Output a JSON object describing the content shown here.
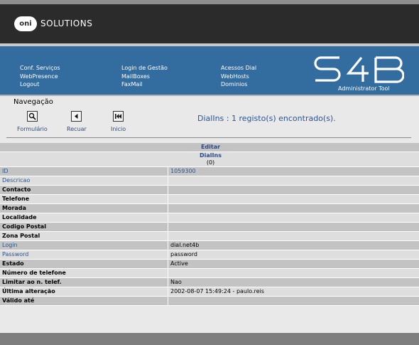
{
  "brand": {
    "logo_mark": "oni",
    "logo_text": "SOLUTIONS",
    "product": "S4B",
    "product_sub": "Administrator Tool"
  },
  "nav": {
    "col1": [
      "Conf. Serviços",
      "WebPresence",
      "Logout"
    ],
    "col2": [
      "Login de Gestão",
      "MailBoxes",
      "FaxMail"
    ],
    "col3": [
      "Acessos Dial",
      "WebHosts",
      "Dominios"
    ]
  },
  "navegacao": {
    "title": "Navegação",
    "buttons": [
      {
        "label": "Formulário",
        "icon": "form-icon"
      },
      {
        "label": "Recuar",
        "icon": "back-icon"
      },
      {
        "label": "Inicio",
        "icon": "first-icon"
      }
    ]
  },
  "result_text": "DialIns : 1 registo(s) encontrado(s).",
  "record": {
    "edit_label": "Editar",
    "section_title": "DialIns",
    "section_index": "(0)",
    "fields": [
      {
        "label": "ID",
        "value": "1059300"
      },
      {
        "label": "Descricao",
        "value": ""
      },
      {
        "label": "Contacto",
        "value": ""
      },
      {
        "label": "Telefone",
        "value": ""
      },
      {
        "label": "Morada",
        "value": ""
      },
      {
        "label": "Localidade",
        "value": ""
      },
      {
        "label": "Codigo Postal",
        "value": ""
      },
      {
        "label": "Zona Postal",
        "value": ""
      },
      {
        "label": "Login",
        "value": "dial.net4b"
      },
      {
        "label": "Password",
        "value": "password"
      },
      {
        "label": "Estado",
        "value": "Active"
      },
      {
        "label": "Número de telefone",
        "value": ""
      },
      {
        "label": "Limitar ao n. telef.",
        "value": "Nao"
      },
      {
        "label": "Última alteração",
        "value": "2002-08-07 15:49:24 - paulo.reis"
      },
      {
        "label": "Válido até",
        "value": ""
      }
    ]
  },
  "colors": {
    "header": "#2b2b2b",
    "navbar": "#336c9f",
    "link": "#2a5490",
    "row_dark": "#c3c3c3",
    "row_light": "#dedede"
  }
}
